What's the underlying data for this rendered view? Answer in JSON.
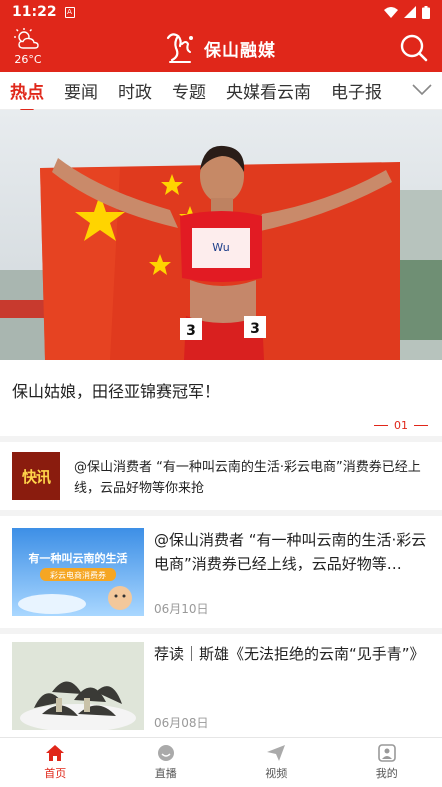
{
  "status_bar": {
    "time": "11:22"
  },
  "header": {
    "temperature": "26°C",
    "app_name": "保山融媒"
  },
  "tabs": [
    {
      "label": "热点",
      "active": true
    },
    {
      "label": "要闻",
      "active": false
    },
    {
      "label": "时政",
      "active": false
    },
    {
      "label": "专题",
      "active": false
    },
    {
      "label": "央媒看云南",
      "active": false
    },
    {
      "label": "电子报",
      "active": false
    }
  ],
  "hero": {
    "caption": "保山姑娘，田径亚锦赛冠军！",
    "bib_name": "Wu",
    "bib_number": "3",
    "page_indicator": "01"
  },
  "flash": {
    "badge": "快讯",
    "text": "@保山消费者 “有一种叫云南的生活·彩云电商”消费券已经上线，云品好物等你来抢"
  },
  "news": [
    {
      "title": "@保山消费者 “有一种叫云南的生活·彩云电商”消费券已经上线，云品好物等…",
      "date": "06月10日",
      "thumb_title": "有一种叫云南的生活",
      "thumb_sub": "彩云电商消费券"
    },
    {
      "title": "荐读｜斯雄《无法拒绝的云南“见手青”》",
      "date": "06月08日"
    }
  ],
  "bottom_nav": [
    {
      "label": "首页",
      "icon": "home-icon",
      "active": true
    },
    {
      "label": "直播",
      "icon": "live-icon",
      "active": false
    },
    {
      "label": "视频",
      "icon": "video-icon",
      "active": false
    },
    {
      "label": "我的",
      "icon": "profile-icon",
      "active": false
    }
  ],
  "colors": {
    "brand_red": "#e0271a",
    "muted_text": "#999999"
  }
}
